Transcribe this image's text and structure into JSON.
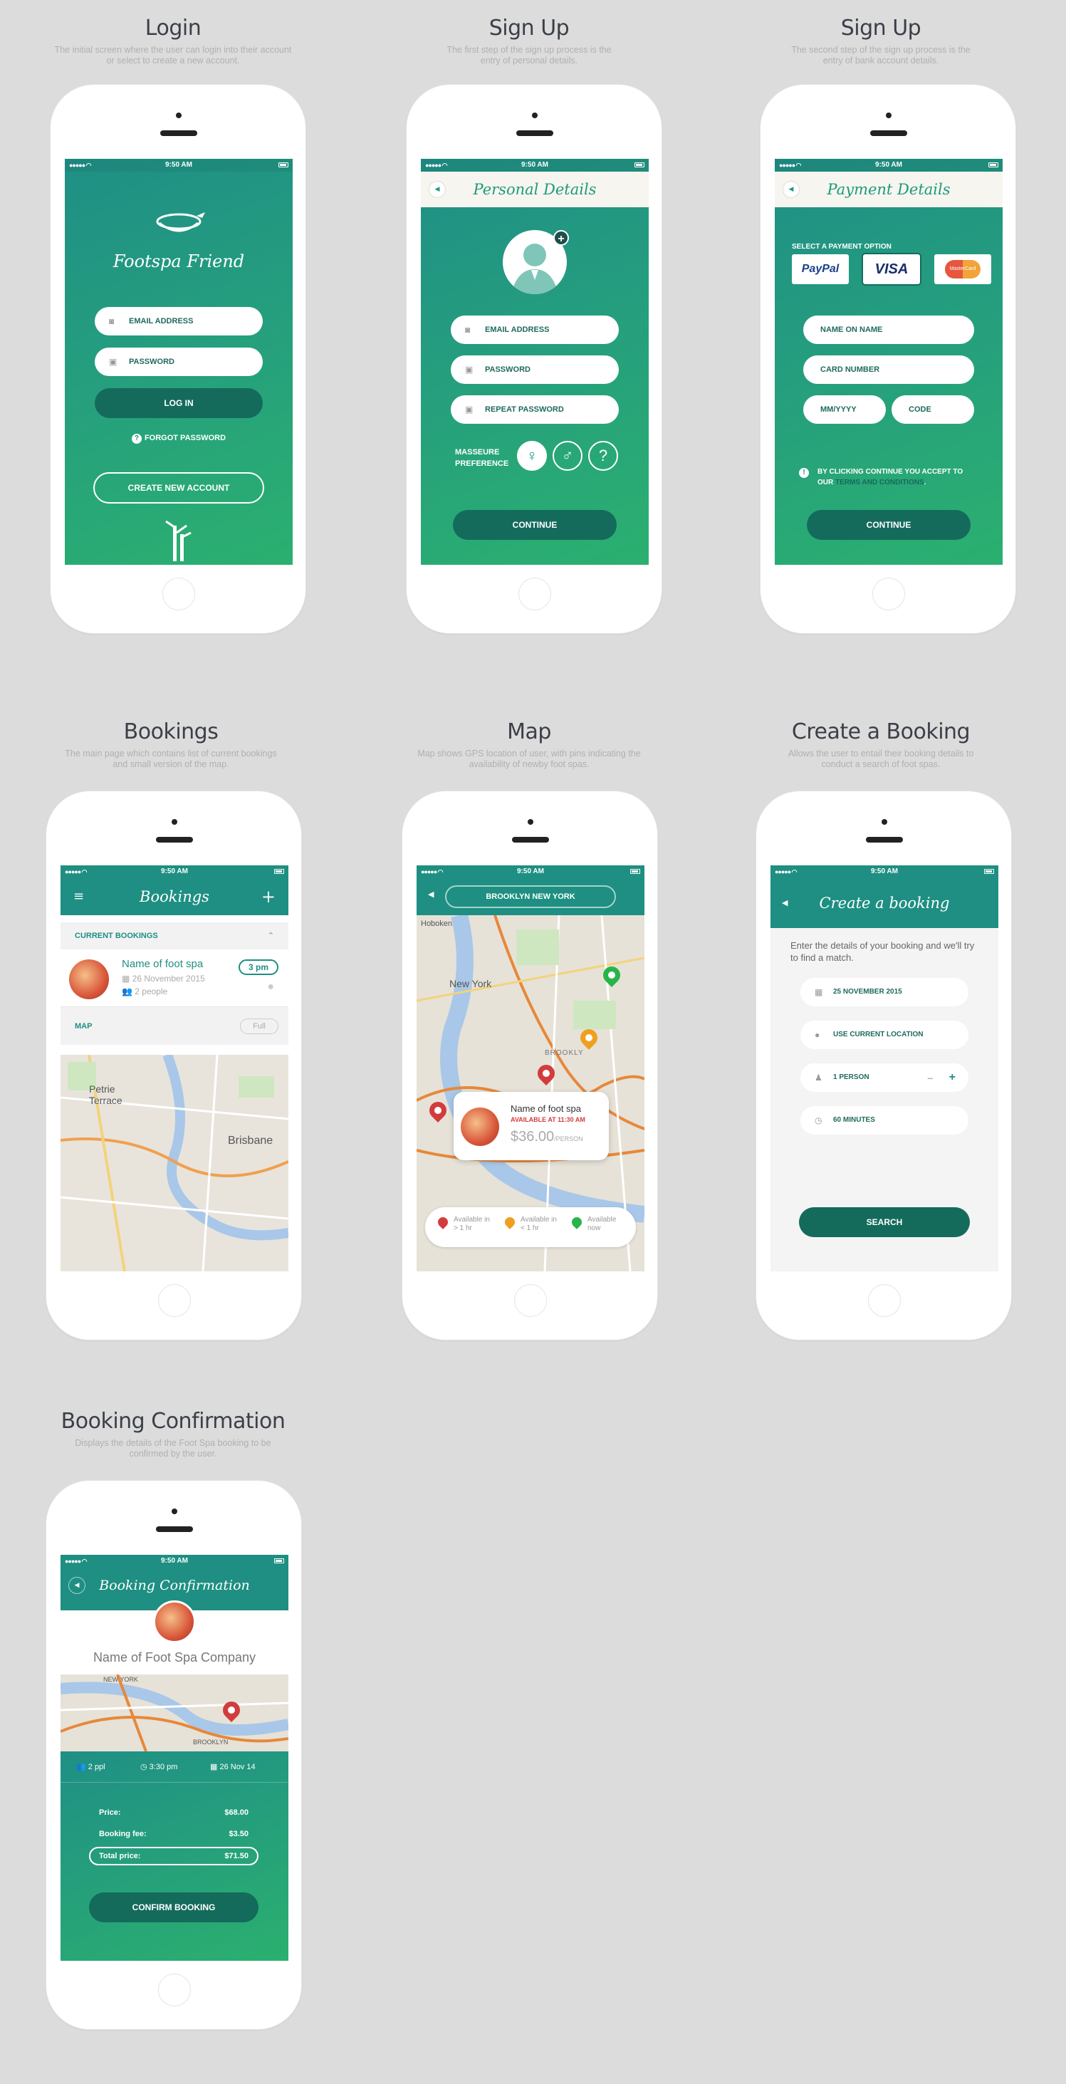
{
  "colors": {
    "primary": "#1e8f82",
    "dark": "#146b5b",
    "pin_red": "#d23c3c",
    "pin_orange": "#f0a020",
    "pin_green": "#28b44a"
  },
  "status_time": "9:50 AM",
  "sections": {
    "login": {
      "title": "Login",
      "desc": "The initial screen where the user can login into their account or select to create a new account."
    },
    "signup1": {
      "title": "Sign Up",
      "desc": "The first step of the sign up process is the entry of personal details."
    },
    "signup2": {
      "title": "Sign Up",
      "desc": "The second step of the sign up process is the entry of bank account details."
    },
    "bookings": {
      "title": "Bookings",
      "desc": "The main page which contains list of current bookings and small version of the map."
    },
    "map": {
      "title": "Map",
      "desc": "Map shows GPS location of user, with pins indicating the availability of newby foot spas."
    },
    "create": {
      "title": "Create a Booking",
      "desc": "Allows the user to entail their booking details to conduct a search of foot spas."
    },
    "confirm": {
      "title": "Booking Confirmation",
      "desc": "Displays the details of the Foot Spa booking to be confirmed by the user."
    }
  },
  "login": {
    "app_name": "Footspa Friend",
    "email": "EMAIL ADDRESS",
    "password": "PASSWORD",
    "login": "LOG IN",
    "forgot": "FORGOT PASSWORD",
    "create": "CREATE NEW ACCOUNT"
  },
  "signup1": {
    "header": "Personal Details",
    "email": "EMAIL ADDRESS",
    "password": "PASSWORD",
    "repeat": "REPEAT PASSWORD",
    "pref_label": "MASSEURE PREFERENCE",
    "continue": "CONTINUE"
  },
  "signup2": {
    "header": "Payment Details",
    "select": "SELECT A PAYMENT OPTION",
    "paypal": "PayPal",
    "visa": "VISA",
    "mastercard": "MasterCard",
    "name": "NAME ON NAME",
    "card": "CARD NUMBER",
    "expiry": "MM/YYYY",
    "code": "CODE",
    "terms_pre": "BY CLICKING CONTINUE YOU ACCEPT TO OUR ",
    "terms_link": "TERMS AND CONDITIONS",
    "terms_post": ".",
    "continue": "CONTINUE"
  },
  "bookings": {
    "header": "Bookings",
    "current": "CURRENT BOOKINGS",
    "spa_name": "Name of foot spa",
    "date": "26 November 2015",
    "people": "2 people",
    "time": "3 pm",
    "map": "MAP",
    "full": "Full",
    "map_labels": [
      "Petrie Terrace",
      "Brisbane"
    ]
  },
  "mapscreen": {
    "location": "BROOKLYN NEW YORK",
    "map_labels": [
      "Hoboken",
      "New York",
      "BROOKLY"
    ],
    "card_name": "Name of foot spa",
    "card_avail": "AVAILABLE AT 11:30 AM",
    "card_price": "$36.00",
    "card_unit": "/PERSON",
    "legend": [
      {
        "text": "Available in > 1 hr",
        "color": "#d23c3c"
      },
      {
        "text": "Available in < 1 hr",
        "color": "#f0a020"
      },
      {
        "text": "Available now",
        "color": "#28b44a"
      }
    ]
  },
  "create": {
    "header": "Create a booking",
    "intro": "Enter the details of your booking and we'll try to find a match.",
    "date": "25 NOVEMBER 2015",
    "location": "USE CURRENT LOCATION",
    "persons": "1 PERSON",
    "minus": "–",
    "plus": "+",
    "duration": "60 MINUTES",
    "search": "SEARCH"
  },
  "confirm": {
    "header": "Booking Confirmation",
    "company": "Name of Foot Spa Company",
    "people": "2 ppl",
    "time": "3:30 pm",
    "date": "26 Nov 14",
    "map_labels": [
      "NEW YORK",
      "BROOKLYN"
    ],
    "rows": [
      {
        "label": "Price:",
        "value": "$68.00"
      },
      {
        "label": "Booking fee:",
        "value": "$3.50"
      }
    ],
    "total_label": "Total price:",
    "total_value": "$71.50",
    "confirm": "CONFIRM BOOKING"
  }
}
